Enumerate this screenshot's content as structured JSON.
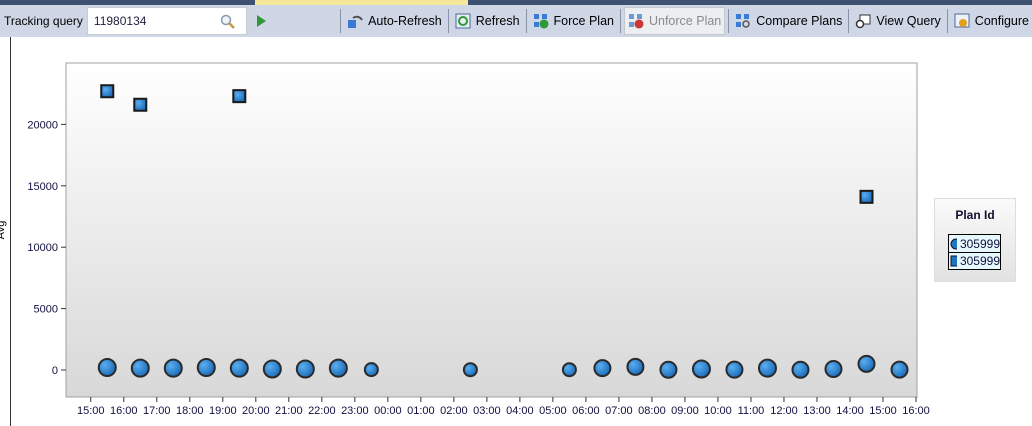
{
  "toolbar": {
    "tracking_label": "Tracking query",
    "query_id": "11980134",
    "buttons": [
      {
        "label": "Auto-Refresh",
        "icon": "auto-refresh-icon",
        "enabled": true
      },
      {
        "label": "Refresh",
        "icon": "refresh-icon",
        "enabled": true
      },
      {
        "label": "Force Plan",
        "icon": "force-plan-icon",
        "enabled": true
      },
      {
        "label": "Unforce Plan",
        "icon": "unforce-plan-icon",
        "enabled": false
      },
      {
        "label": "Compare Plans",
        "icon": "compare-plans-icon",
        "enabled": true
      },
      {
        "label": "View Query",
        "icon": "view-query-icon",
        "enabled": true
      },
      {
        "label": "Configure",
        "icon": "configure-icon",
        "enabled": true
      }
    ]
  },
  "legend": {
    "title": "Plan Id",
    "items": [
      {
        "label": "305999",
        "marker": "circle"
      },
      {
        "label": "305999",
        "marker": "square"
      }
    ]
  },
  "chart_data": {
    "type": "scatter",
    "ylabel": "Avg",
    "xlabel": "",
    "ylim": [
      -2200,
      25000
    ],
    "xlim": [
      "14:15",
      "16:00 (+1 day)"
    ],
    "yticks": [
      0,
      5000,
      10000,
      15000,
      20000
    ],
    "xticks": [
      "15:00",
      "16:00",
      "17:00",
      "18:00",
      "19:00",
      "20:00",
      "21:00",
      "22:00",
      "23:00",
      "00:00",
      "01:00",
      "02:00",
      "03:00",
      "04:00",
      "05:00",
      "06:00",
      "07:00",
      "08:00",
      "09:00",
      "10:00",
      "11:00",
      "12:00",
      "13:00",
      "14:00",
      "15:00",
      "16:00"
    ],
    "grid": false,
    "legend_position": "right",
    "marker_color": "#2b86d0",
    "series": [
      {
        "name": "305999",
        "marker": "circle",
        "points": [
          {
            "x": "15:30",
            "y": 200,
            "size": "large"
          },
          {
            "x": "16:30",
            "y": 150,
            "size": "large"
          },
          {
            "x": "17:30",
            "y": 150,
            "size": "large"
          },
          {
            "x": "18:30",
            "y": 200,
            "size": "large"
          },
          {
            "x": "19:30",
            "y": 150,
            "size": "large"
          },
          {
            "x": "20:30",
            "y": 80,
            "size": "large"
          },
          {
            "x": "21:30",
            "y": 80,
            "size": "large"
          },
          {
            "x": "22:30",
            "y": 150,
            "size": "large"
          },
          {
            "x": "23:30",
            "y": 30,
            "size": "small"
          },
          {
            "x": "02:30",
            "y": 20,
            "size": "small"
          },
          {
            "x": "05:30",
            "y": 20,
            "size": "small"
          },
          {
            "x": "06:30",
            "y": 150,
            "size": "medium"
          },
          {
            "x": "07:30",
            "y": 250,
            "size": "medium"
          },
          {
            "x": "08:30",
            "y": 20,
            "size": "medium"
          },
          {
            "x": "09:30",
            "y": 80,
            "size": "large"
          },
          {
            "x": "10:30",
            "y": 30,
            "size": "medium"
          },
          {
            "x": "11:30",
            "y": 150,
            "size": "large"
          },
          {
            "x": "12:30",
            "y": 20,
            "size": "medium"
          },
          {
            "x": "13:30",
            "y": 80,
            "size": "medium"
          },
          {
            "x": "14:30",
            "y": 500,
            "size": "medium"
          },
          {
            "x": "15:30",
            "y": 30,
            "size": "medium"
          }
        ]
      },
      {
        "name": "305999",
        "marker": "square",
        "points": [
          {
            "x": "15:30",
            "y": 22700
          },
          {
            "x": "16:30",
            "y": 21600
          },
          {
            "x": "19:30",
            "y": 22300
          },
          {
            "x": "14:30",
            "y": 14100
          }
        ]
      }
    ]
  }
}
